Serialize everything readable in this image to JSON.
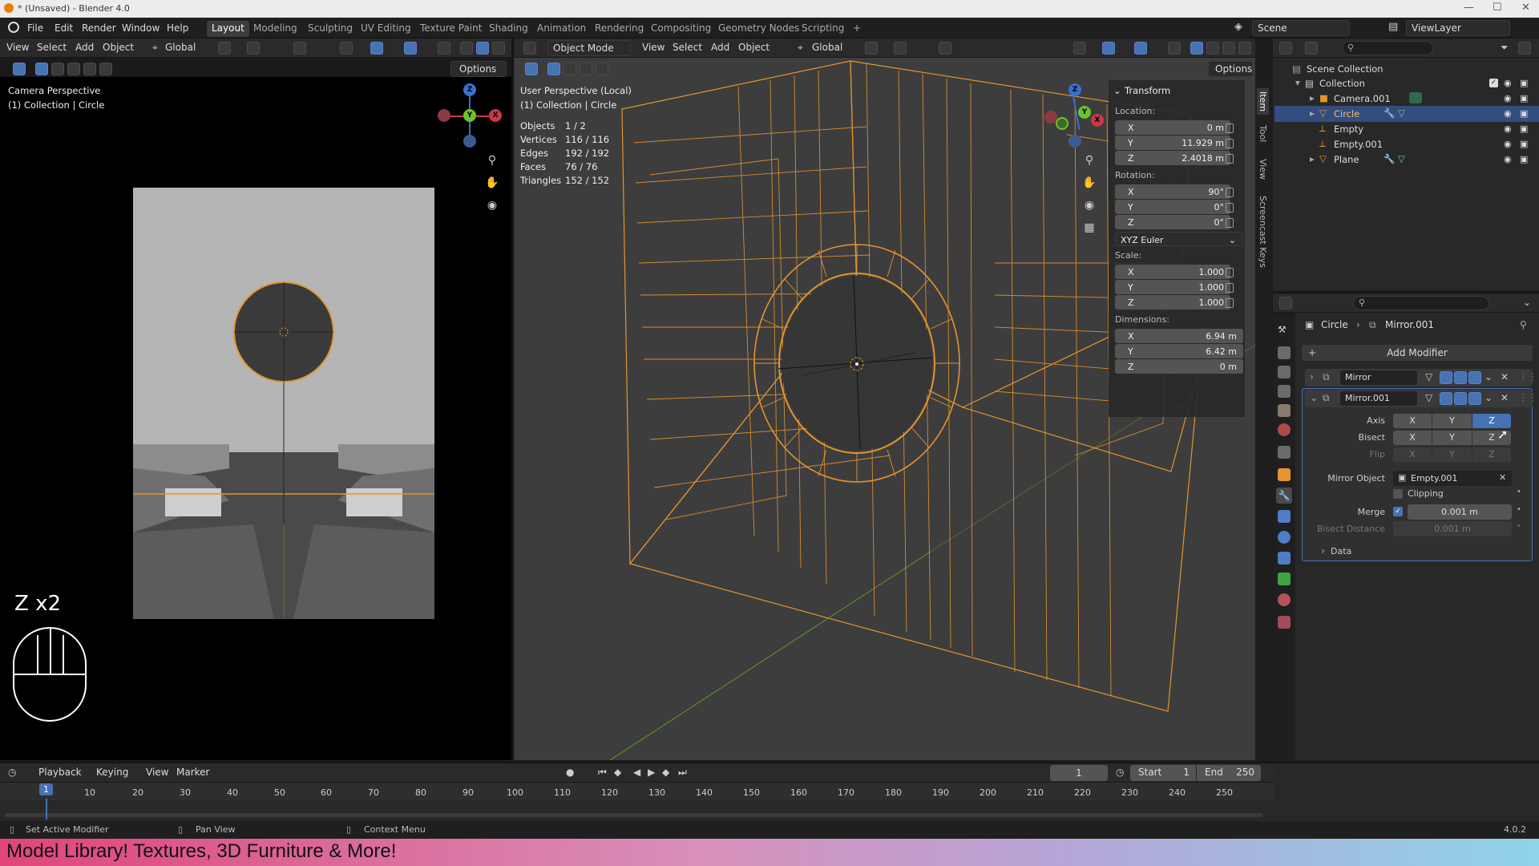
{
  "window": {
    "title": "* (Unsaved) - Blender 4.0"
  },
  "menus": [
    "File",
    "Edit",
    "Render",
    "Window",
    "Help"
  ],
  "workspaces": [
    "Layout",
    "Modeling",
    "Sculpting",
    "UV Editing",
    "Texture Paint",
    "Shading",
    "Animation",
    "Rendering",
    "Compositing",
    "Geometry Nodes",
    "Scripting"
  ],
  "active_workspace": "Layout",
  "top_right": {
    "scene": "Scene",
    "view_layer": "ViewLayer"
  },
  "left_view": {
    "menus": [
      "View",
      "Select",
      "Add",
      "Object"
    ],
    "orientation": "Global",
    "options": "Options",
    "overlay_title": "Camera Perspective",
    "overlay_sub": "(1) Collection | Circle",
    "key_hint": "Z x2"
  },
  "main_view": {
    "mode": "Object Mode",
    "menus": [
      "View",
      "Select",
      "Add",
      "Object"
    ],
    "orientation": "Global",
    "options": "Options",
    "overlay_title": "User Perspective (Local)",
    "overlay_sub": "(1) Collection | Circle",
    "stats": [
      {
        "label": "Objects",
        "value": "1 / 2"
      },
      {
        "label": "Vertices",
        "value": "116 / 116"
      },
      {
        "label": "Edges",
        "value": "192 / 192"
      },
      {
        "label": "Faces",
        "value": "76 / 76"
      },
      {
        "label": "Triangles",
        "value": "152 / 152"
      }
    ]
  },
  "n_panel": {
    "header": "Transform",
    "tabs": [
      "Item",
      "Tool",
      "View",
      "Screencast Keys"
    ],
    "location_label": "Location:",
    "location": [
      {
        "axis": "X",
        "value": "0 m"
      },
      {
        "axis": "Y",
        "value": "11.929 m"
      },
      {
        "axis": "Z",
        "value": "2.4018 m"
      }
    ],
    "rotation_label": "Rotation:",
    "rotation": [
      {
        "axis": "X",
        "value": "90°"
      },
      {
        "axis": "Y",
        "value": "0°"
      },
      {
        "axis": "Z",
        "value": "0°"
      }
    ],
    "rotation_mode": "XYZ Euler",
    "scale_label": "Scale:",
    "scale": [
      {
        "axis": "X",
        "value": "1.000"
      },
      {
        "axis": "Y",
        "value": "1.000"
      },
      {
        "axis": "Z",
        "value": "1.000"
      }
    ],
    "dimensions_label": "Dimensions:",
    "dimensions": [
      {
        "axis": "X",
        "value": "6.94 m"
      },
      {
        "axis": "Y",
        "value": "6.42 m"
      },
      {
        "axis": "Z",
        "value": "0 m"
      }
    ]
  },
  "outliner": {
    "root": "Scene Collection",
    "collection": "Collection",
    "items": [
      "Camera.001",
      "Circle",
      "Empty",
      "Empty.001",
      "Plane"
    ],
    "selected": "Circle"
  },
  "properties": {
    "breadcrumb_obj": "Circle",
    "breadcrumb_mod": "Mirror.001",
    "add_modifier": "Add Modifier",
    "modifiers": [
      "Mirror",
      "Mirror.001"
    ],
    "axis_label": "Axis",
    "bisect_label": "Bisect",
    "flip_label": "Flip",
    "axes": [
      "X",
      "Y",
      "Z"
    ],
    "active_axis": "Z",
    "mirror_object_label": "Mirror Object",
    "mirror_object": "Empty.001",
    "clipping_label": "Clipping",
    "merge_label": "Merge",
    "merge_value": "0.001 m",
    "bisect_distance_label": "Bisect Distance",
    "bisect_distance_value": "0.001 m",
    "data_label": "Data"
  },
  "timeline": {
    "menus": [
      "Playback",
      "Keying",
      "View",
      "Marker"
    ],
    "current_frame": "1",
    "start_label": "Start",
    "start": "1",
    "end_label": "End",
    "end": "250",
    "ticks": [
      "1",
      "10",
      "20",
      "30",
      "40",
      "50",
      "60",
      "70",
      "80",
      "90",
      "100",
      "110",
      "120",
      "130",
      "140",
      "150",
      "160",
      "170",
      "180",
      "190",
      "200",
      "210",
      "220",
      "230",
      "240",
      "250"
    ]
  },
  "status": {
    "left": "Set Active Modifier",
    "mid": "Pan View",
    "right": "Context Menu",
    "version": "4.0.2"
  },
  "banner": "Model Library! Textures, 3D Furniture & More!",
  "colors": {
    "accent": "#4772b3",
    "selection": "#e5942e",
    "banner_start": "#e0457b",
    "banner_end": "#8fd3e8"
  }
}
